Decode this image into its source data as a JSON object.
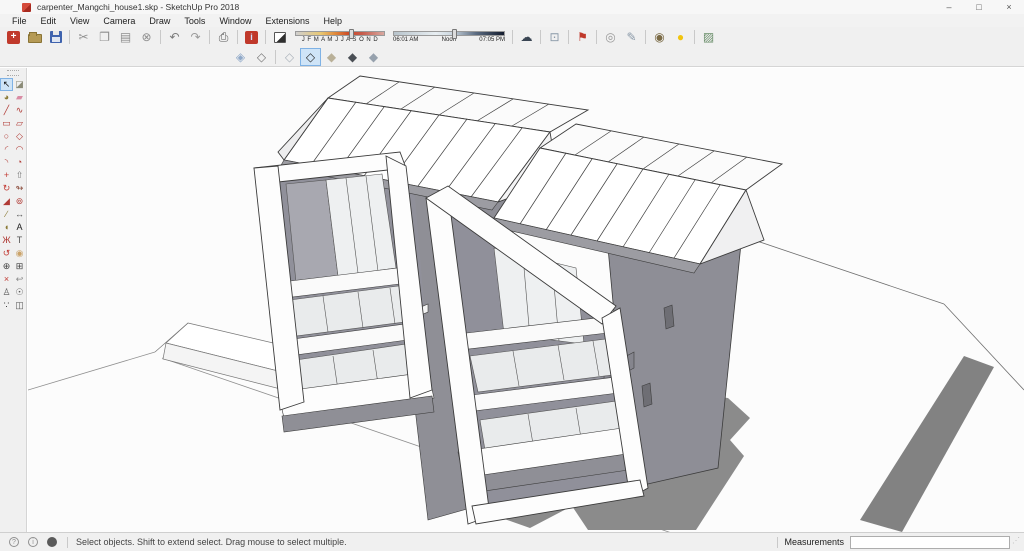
{
  "window": {
    "title": "carpenter_Mangchi_house1.skp - SketchUp Pro 2018",
    "controls": {
      "minimize": "–",
      "maximize": "□",
      "close": "×"
    }
  },
  "menu": {
    "items": [
      "File",
      "Edit",
      "View",
      "Camera",
      "Draw",
      "Tools",
      "Window",
      "Extensions",
      "Help"
    ]
  },
  "toolbar": {
    "buttons": [
      {
        "name": "new",
        "glyph": "+"
      },
      {
        "name": "open",
        "glyph": ""
      },
      {
        "name": "save",
        "glyph": ""
      },
      {
        "name": "cut",
        "glyph": "✂",
        "color": "#8f8f8f"
      },
      {
        "name": "copy",
        "glyph": "❐",
        "color": "#8f8f8f"
      },
      {
        "name": "paste",
        "glyph": "▤",
        "color": "#8f8f8f"
      },
      {
        "name": "erase",
        "glyph": "⊗",
        "color": "#8f8f8f"
      },
      {
        "name": "undo",
        "glyph": "↶",
        "color": "#7a7a7a"
      },
      {
        "name": "redo",
        "glyph": "↷",
        "color": "#9a9a9a"
      },
      {
        "name": "print",
        "glyph": "⎙",
        "color": "#555555"
      },
      {
        "name": "model-info",
        "glyph": "i"
      }
    ]
  },
  "shadows": {
    "months": "J F M A M J J A S O N D",
    "sunrise": "06:01 AM",
    "noon": "Noon",
    "sunset": "07:05 PM"
  },
  "extensions_toolbar": {
    "buttons": [
      {
        "name": "add-location",
        "glyph": "☁",
        "color": "#3a4553"
      },
      {
        "name": "share-model",
        "glyph": "⊡",
        "color": "#8a99a8"
      },
      {
        "name": "styles-flag",
        "glyph": "⚑",
        "color": "#c0392b"
      },
      {
        "name": "orbit-wheel",
        "glyph": "◎",
        "color": "#999999"
      },
      {
        "name": "pencil-tool",
        "glyph": "✎",
        "color": "#8a99a8"
      },
      {
        "name": "geo-globe",
        "glyph": "◉",
        "color": "#7a6a45"
      },
      {
        "name": "light-bulb",
        "glyph": "●",
        "color": "#f1c40f"
      },
      {
        "name": "photo-texture",
        "glyph": "▨",
        "color": "#6b8f6b"
      }
    ]
  },
  "styles_toolbar": {
    "selected": "Hidden Line",
    "buttons": [
      {
        "name": "x-ray",
        "glyph": "◈",
        "color": "#8fa8c8"
      },
      {
        "name": "back-edges",
        "glyph": "◇",
        "color": "#777777"
      },
      {
        "name": "wireframe",
        "glyph": "◇",
        "color": "#aab2bb"
      },
      {
        "name": "hidden-line",
        "glyph": "◇",
        "color": "#2e2e2e"
      },
      {
        "name": "shaded",
        "glyph": "◆",
        "color": "#b9b098"
      },
      {
        "name": "shaded-with-textures",
        "glyph": "◆",
        "color": "#4a4f55"
      },
      {
        "name": "monochrome",
        "glyph": "◆",
        "color": "#96a1ad"
      }
    ]
  },
  "left_toolbar": {
    "tools": [
      {
        "name": "select",
        "glyph": "↖",
        "color": "#111111"
      },
      {
        "name": "make-component",
        "glyph": "◪",
        "color": "#8b8b77"
      },
      {
        "name": "paint-bucket",
        "glyph": "◕",
        "color": "#8a7a35"
      },
      {
        "name": "eraser",
        "glyph": "▰",
        "color": "#d98ca5"
      },
      {
        "name": "line",
        "glyph": "╱",
        "color": "#b03a35"
      },
      {
        "name": "freehand",
        "glyph": "∿",
        "color": "#b03a35"
      },
      {
        "name": "rectangle",
        "glyph": "▭",
        "color": "#b03a35"
      },
      {
        "name": "rotated-rectangle",
        "glyph": "▱",
        "color": "#b03a35"
      },
      {
        "name": "circle",
        "glyph": "○",
        "color": "#b03a35"
      },
      {
        "name": "polygon",
        "glyph": "◇",
        "color": "#b03a35"
      },
      {
        "name": "arc",
        "glyph": "◜",
        "color": "#b03a35"
      },
      {
        "name": "two-point-arc",
        "glyph": "◠",
        "color": "#b03a35"
      },
      {
        "name": "three-point-arc",
        "glyph": "◝",
        "color": "#b03a35"
      },
      {
        "name": "pie",
        "glyph": "◔",
        "color": "#b03a35"
      },
      {
        "name": "move",
        "glyph": "+",
        "color": "#c23c35"
      },
      {
        "name": "push-pull",
        "glyph": "⇧",
        "color": "#777777"
      },
      {
        "name": "rotate",
        "glyph": "↻",
        "color": "#c23c35"
      },
      {
        "name": "follow-me",
        "glyph": "↬",
        "color": "#8a4a3a"
      },
      {
        "name": "scale",
        "glyph": "◢",
        "color": "#b03a35"
      },
      {
        "name": "offset",
        "glyph": "⊚",
        "color": "#b03a35"
      },
      {
        "name": "tape-measure",
        "glyph": "∕",
        "color": "#8a7a35"
      },
      {
        "name": "dimension",
        "glyph": "↔",
        "color": "#555555"
      },
      {
        "name": "protractor",
        "glyph": "◖",
        "color": "#8a7a35"
      },
      {
        "name": "text",
        "glyph": "A",
        "color": "#222222"
      },
      {
        "name": "axes",
        "glyph": "Ж",
        "color": "#b03a35"
      },
      {
        "name": "three-d-text",
        "glyph": "T",
        "color": "#555555"
      },
      {
        "name": "orbit",
        "glyph": "↺",
        "color": "#c23c35"
      },
      {
        "name": "pan",
        "glyph": "◉",
        "color": "#caa36a"
      },
      {
        "name": "zoom",
        "glyph": "⊕",
        "color": "#444444"
      },
      {
        "name": "zoom-window",
        "glyph": "⊞",
        "color": "#444444"
      },
      {
        "name": "zoom-extents",
        "glyph": "×",
        "color": "#c23c35"
      },
      {
        "name": "previous",
        "glyph": "↩",
        "color": "#888888"
      },
      {
        "name": "position-camera",
        "glyph": "♙",
        "color": "#555555"
      },
      {
        "name": "look-around",
        "glyph": "☉",
        "color": "#555555"
      },
      {
        "name": "walk",
        "glyph": "∵",
        "color": "#333333"
      },
      {
        "name": "section-plane",
        "glyph": "◫",
        "color": "#555555"
      }
    ]
  },
  "statusbar": {
    "icons": [
      {
        "name": "geo-hint",
        "glyph": "?"
      },
      {
        "name": "credits",
        "glyph": "i"
      },
      {
        "name": "user",
        "glyph": "●"
      }
    ],
    "message": "Select objects. Shift to extend select. Drag mouse to select multiple.",
    "measurements_label": "Measurements",
    "measurements_value": ""
  }
}
